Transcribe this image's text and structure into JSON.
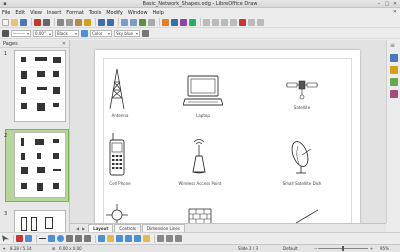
{
  "window": {
    "title": "Basic_Network_Shapes.odg - LibreOffice Draw"
  },
  "menu": [
    "File",
    "Edit",
    "View",
    "Insert",
    "Format",
    "Tools",
    "Modify",
    "Window",
    "Help"
  ],
  "toolbar2": {
    "line_width": "0.00\"",
    "line_color": "Black",
    "area_style": "Color",
    "area_color": "Sky blue"
  },
  "pages_panel": {
    "title": "Pages",
    "page_numbers": [
      "1",
      "2",
      "3"
    ],
    "selected_page": 2
  },
  "canvas": {
    "shapes": [
      {
        "label": "Antenna",
        "icon": "antenna-icon"
      },
      {
        "label": "Laptop",
        "icon": "laptop-icon"
      },
      {
        "label": "Satellite",
        "icon": "satellite-icon"
      },
      {
        "label": "Cell Phone",
        "icon": "cell-phone-icon"
      },
      {
        "label": "Wireless Access Point",
        "icon": "wireless-access-point-icon"
      },
      {
        "label": "Small Satellite Dish",
        "icon": "satellite-dish-icon"
      }
    ]
  },
  "tabs": [
    "Layout",
    "Controls",
    "Dimension Lines"
  ],
  "active_tab": "Layout",
  "status": {
    "position": "8.28 / 5.14",
    "size": "0.00 x 0.00",
    "slide": "Slide 2 / 3",
    "layout": "Default",
    "zoom": "95%"
  },
  "colors": {
    "selection_fill": "#b7d79a",
    "selection_border": "#7fb24f",
    "canvas_bg": "#e2e2e2",
    "page_bg": "#ffffff"
  }
}
